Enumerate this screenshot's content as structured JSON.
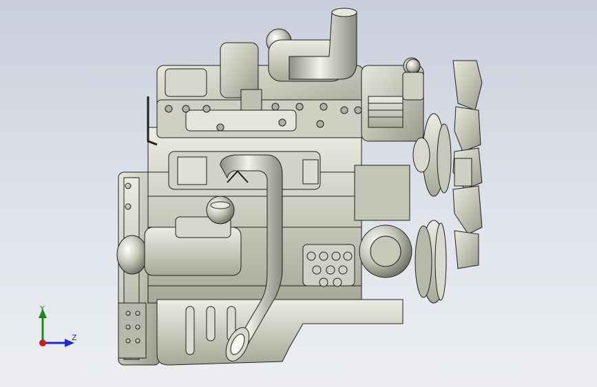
{
  "viewport": {
    "background_top": "#c9cedc",
    "background_bottom": "#eceef2"
  },
  "model": {
    "part_color": "#c9c9bd",
    "edge_color": "#1e1e1e",
    "shadow_color": "#8c8c80",
    "highlight_color": "#f4f4ec"
  },
  "triad": {
    "y_label": "Y",
    "z_label": "Z",
    "y_color": "#1a8a1a",
    "z_color": "#1a2bcc",
    "x_color": "#cc1a1a"
  }
}
